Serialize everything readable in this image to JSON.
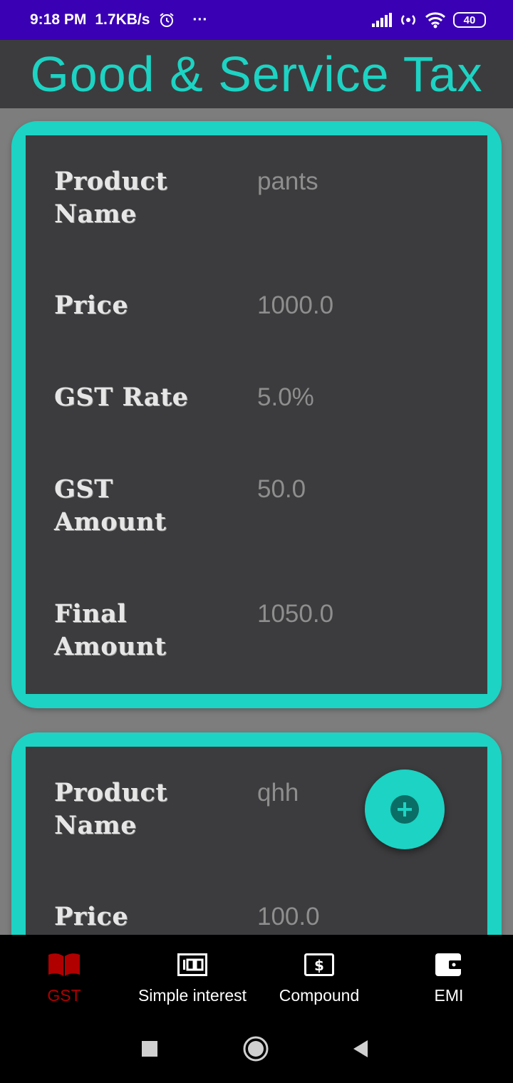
{
  "status_bar": {
    "time": "9:18 PM",
    "speed": "1.7KB/s",
    "more": "···",
    "battery": "40"
  },
  "header": {
    "title": "Good & Service Tax"
  },
  "cards": [
    {
      "rows": [
        {
          "label": "Product Name",
          "value": "pants"
        },
        {
          "label": "Price",
          "value": "1000.0"
        },
        {
          "label": "GST Rate",
          "value": "5.0%"
        },
        {
          "label": "GST Amount",
          "value": "50.0"
        },
        {
          "label": "Final Amount",
          "value": "1050.0"
        }
      ]
    },
    {
      "rows": [
        {
          "label": "Product Name",
          "value": "qhh"
        },
        {
          "label": "Price",
          "value": "100.0"
        }
      ]
    }
  ],
  "fab": {
    "icon": "plus-icon"
  },
  "bottom_nav": {
    "items": [
      {
        "label": "GST",
        "icon": "book-icon",
        "active": true
      },
      {
        "label": "Simple interest",
        "icon": "hundred-icon",
        "active": false
      },
      {
        "label": "Compound",
        "icon": "dollar-icon",
        "active": false
      },
      {
        "label": "EMI",
        "icon": "wallet-icon",
        "active": false
      }
    ]
  },
  "colors": {
    "accent": "#1dd3c3",
    "status_bar": "#3a00b3",
    "active_nav": "#b00000",
    "card_bg": "#3c3c3e"
  }
}
